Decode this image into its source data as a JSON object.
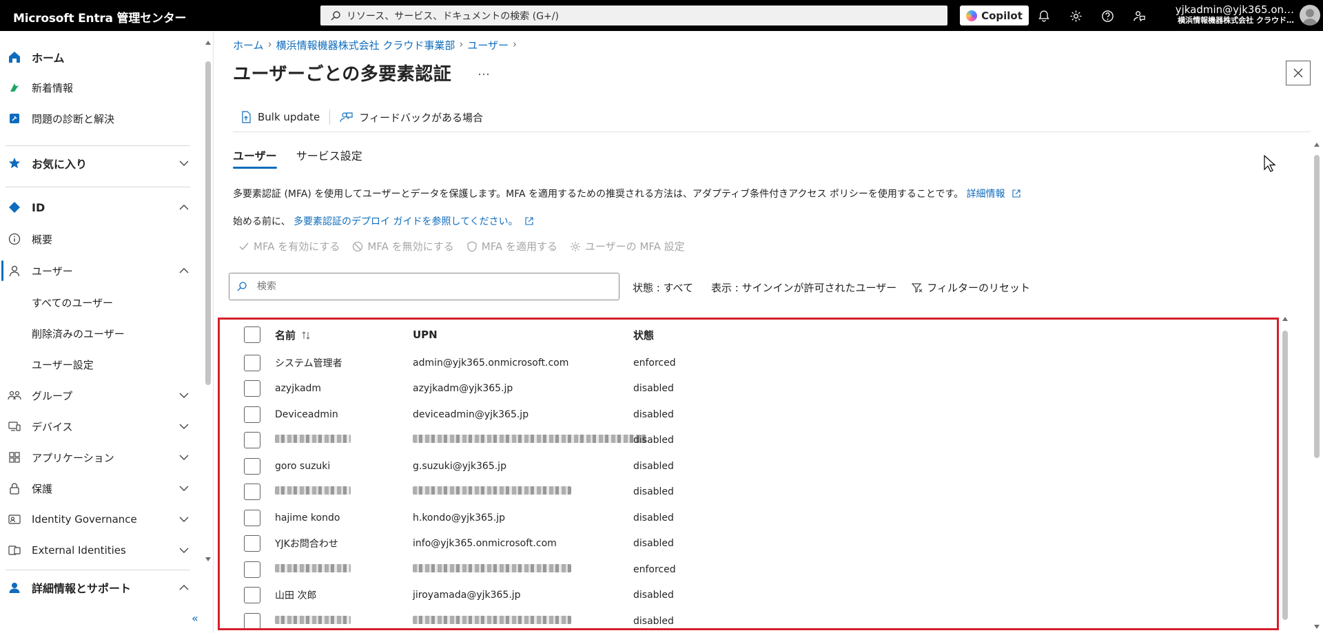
{
  "topbar": {
    "brand": "Microsoft Entra 管理センター",
    "search_placeholder": "リソース、サービス、ドキュメントの検索 (G+/)",
    "copilot_label": "Copilot",
    "user_name": "yjkadmin@yjk365.on…",
    "user_org": "横浜情報機器株式会社 クラウド…"
  },
  "sidebar": {
    "home": "ホーム",
    "whats_new": "新着情報",
    "diagnose": "問題の診断と解決",
    "favorites": "お気に入り",
    "id": "ID",
    "overview": "概要",
    "users": "ユーザー",
    "all_users": "すべてのユーザー",
    "deleted_users": "削除済みのユーザー",
    "user_settings": "ユーザー設定",
    "groups": "グループ",
    "devices": "デバイス",
    "applications": "アプリケーション",
    "protection": "保護",
    "identity_governance": "Identity Governance",
    "external_identities": "External Identities",
    "learn_support": "詳細情報とサポート",
    "collapse": "«"
  },
  "breadcrumb": [
    "ホーム",
    "横浜情報機器株式会社 クラウド事業部",
    "ユーザー"
  ],
  "page": {
    "title": "ユーザーごとの多要素認証",
    "more": "…",
    "bulk_update": "Bulk update",
    "feedback": "フィードバックがある場合",
    "tabs": [
      "ユーザー",
      "サービス設定"
    ],
    "desc_text": "多要素認証 (MFA) を使用してユーザーとデータを保護します。MFA を適用するための推奨される方法は、アダプティブ条件付きアクセス ポリシーを使用することです。",
    "desc_link": "詳細情報",
    "desc2_text": "始める前に、",
    "desc2_link": "多要素認証のデプロイ ガイドを参照してください。",
    "actions": {
      "enable": "MFA を有効にする",
      "disable": "MFA を無効にする",
      "enforce": "MFA を適用する",
      "settings": "ユーザーの MFA 設定"
    },
    "search_placeholder": "検索",
    "filter_state": "状態 : すべて",
    "filter_show": "表示 : サインインが許可されたユーザー",
    "filter_reset": "フィルターのリセット"
  },
  "table": {
    "headers": {
      "name": "名前",
      "upn": "UPN",
      "state": "状態"
    },
    "rows": [
      {
        "name": "システム管理者",
        "upn": "admin@yjk365.onmicrosoft.com",
        "state": "enforced",
        "redacted": false
      },
      {
        "name": "azyjkadm",
        "upn": "azyjkadm@yjk365.jp",
        "state": "disabled",
        "redacted": false
      },
      {
        "name": "Deviceadmin",
        "upn": "deviceadmin@yjk365.jp",
        "state": "disabled",
        "redacted": false
      },
      {
        "name": "",
        "upn": "",
        "state": "disabled",
        "redacted": true
      },
      {
        "name": "goro suzuki",
        "upn": "g.suzuki@yjk365.jp",
        "state": "disabled",
        "redacted": false
      },
      {
        "name": "",
        "upn": "",
        "state": "disabled",
        "redacted": true
      },
      {
        "name": "hajime kondo",
        "upn": "h.kondo@yjk365.jp",
        "state": "disabled",
        "redacted": false
      },
      {
        "name": "YJKお問合わせ",
        "upn": "info@yjk365.onmicrosoft.com",
        "state": "disabled",
        "redacted": false
      },
      {
        "name": "",
        "upn": "",
        "state": "enforced",
        "redacted": true
      },
      {
        "name": "山田 次郎",
        "upn": "jiroyamada@yjk365.jp",
        "state": "disabled",
        "redacted": false
      },
      {
        "name": "",
        "upn": "",
        "state": "disabled",
        "redacted": true
      }
    ]
  },
  "colors": {
    "accent": "#0f6cbd",
    "highlight_border": "#d4202c",
    "topbar": "#000000"
  }
}
